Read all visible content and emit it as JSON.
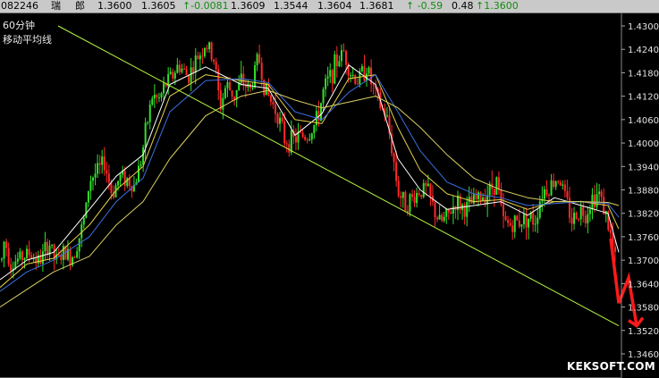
{
  "quote_bar": {
    "code": "082246",
    "name_1": "瑞",
    "name_2": "郎",
    "v1": "1.3600",
    "v2": "1.3605",
    "change": "↑-0.0081",
    "v3": "1.3609",
    "v4": "1.3544",
    "v5": "1.3604",
    "v6": "1.3681",
    "pct": "↑ -0.59",
    "v7": "0.48",
    "last": "↑1.3600"
  },
  "chart_data": {
    "type": "candlestick",
    "title": "60分钟",
    "subtitle": "移动平均线",
    "y_ticks": [
      "1.4300",
      "1.4240",
      "1.4180",
      "1.4120",
      "1.4060",
      "1.4000",
      "1.3940",
      "1.3880",
      "1.3820",
      "1.3760",
      "1.3700",
      "1.3640",
      "1.3580",
      "1.3520",
      "1.3460"
    ],
    "ylim": [
      1.3455,
      1.431
    ],
    "price_path": [
      [
        0,
        1.3665
      ],
      [
        5,
        1.3755
      ],
      [
        12,
        1.369
      ],
      [
        22,
        1.3705
      ],
      [
        33,
        1.3718
      ],
      [
        44,
        1.3695
      ],
      [
        55,
        1.3745
      ],
      [
        62,
        1.3695
      ],
      [
        72,
        1.372
      ],
      [
        80,
        1.3705
      ],
      [
        88,
        1.3755
      ],
      [
        95,
        1.381
      ],
      [
        100,
        1.3905
      ],
      [
        110,
        1.393
      ],
      [
        117,
        1.395
      ],
      [
        125,
        1.387
      ],
      [
        135,
        1.3915
      ],
      [
        143,
        1.3905
      ],
      [
        150,
        1.389
      ],
      [
        158,
        1.396
      ],
      [
        163,
        1.403
      ],
      [
        170,
        1.412
      ],
      [
        178,
        1.411
      ],
      [
        185,
        1.415
      ],
      [
        192,
        1.417
      ],
      [
        200,
        1.42
      ],
      [
        210,
        1.417
      ],
      [
        220,
        1.4215
      ],
      [
        230,
        1.4255
      ],
      [
        240,
        1.421
      ],
      [
        246,
        1.409
      ],
      [
        253,
        1.415
      ],
      [
        262,
        1.412
      ],
      [
        270,
        1.416
      ],
      [
        280,
        1.4135
      ],
      [
        289,
        1.4225
      ],
      [
        295,
        1.415
      ],
      [
        302,
        1.411
      ],
      [
        310,
        1.408
      ],
      [
        318,
        1.401
      ],
      [
        326,
        1.4005
      ],
      [
        336,
        1.4018
      ],
      [
        345,
        1.402
      ],
      [
        355,
        1.406
      ],
      [
        362,
        1.4135
      ],
      [
        370,
        1.4175
      ],
      [
        378,
        1.4215
      ],
      [
        385,
        1.4235
      ],
      [
        392,
        1.418
      ],
      [
        400,
        1.416
      ],
      [
        410,
        1.4195
      ],
      [
        417,
        1.414
      ],
      [
        425,
        1.4095
      ],
      [
        432,
        1.407
      ],
      [
        438,
        1.399
      ],
      [
        445,
        1.388
      ],
      [
        452,
        1.3845
      ],
      [
        460,
        1.3855
      ],
      [
        470,
        1.388
      ],
      [
        478,
        1.388
      ],
      [
        485,
        1.383
      ],
      [
        492,
        1.3795
      ],
      [
        500,
        1.381
      ],
      [
        510,
        1.385
      ],
      [
        520,
        1.383
      ],
      [
        530,
        1.385
      ],
      [
        540,
        1.3865
      ],
      [
        548,
        1.388
      ],
      [
        556,
        1.3905
      ],
      [
        562,
        1.38
      ],
      [
        570,
        1.379
      ],
      [
        580,
        1.38
      ],
      [
        590,
        1.381
      ],
      [
        598,
        1.38
      ],
      [
        606,
        1.3875
      ],
      [
        615,
        1.389
      ],
      [
        625,
        1.3915
      ],
      [
        632,
        1.386
      ],
      [
        640,
        1.38
      ],
      [
        648,
        1.383
      ],
      [
        655,
        1.382
      ],
      [
        662,
        1.386
      ],
      [
        670,
        1.387
      ],
      [
        676,
        1.383
      ],
      [
        682,
        1.377
      ],
      [
        688,
        1.37
      ],
      [
        692,
        1.3668
      ]
    ],
    "moving_averages": [
      {
        "color": "#ffffff",
        "values": [
          [
            0,
            1.365
          ],
          [
            30,
            1.37
          ],
          [
            60,
            1.372
          ],
          [
            100,
            1.383
          ],
          [
            130,
            1.3915
          ],
          [
            160,
            1.397
          ],
          [
            190,
            1.415
          ],
          [
            230,
            1.4195
          ],
          [
            270,
            1.415
          ],
          [
            300,
            1.414
          ],
          [
            330,
            1.402
          ],
          [
            360,
            1.4075
          ],
          [
            390,
            1.42
          ],
          [
            420,
            1.415
          ],
          [
            445,
            1.396
          ],
          [
            470,
            1.388
          ],
          [
            500,
            1.383
          ],
          [
            530,
            1.384
          ],
          [
            560,
            1.385
          ],
          [
            590,
            1.3815
          ],
          [
            620,
            1.386
          ],
          [
            650,
            1.384
          ],
          [
            680,
            1.382
          ],
          [
            692,
            1.372
          ]
        ]
      },
      {
        "color": "#e6d24a",
        "values": [
          [
            0,
            1.363
          ],
          [
            30,
            1.369
          ],
          [
            60,
            1.3705
          ],
          [
            100,
            1.379
          ],
          [
            130,
            1.388
          ],
          [
            160,
            1.394
          ],
          [
            190,
            1.412
          ],
          [
            230,
            1.4175
          ],
          [
            270,
            1.416
          ],
          [
            300,
            1.415
          ],
          [
            330,
            1.406
          ],
          [
            360,
            1.405
          ],
          [
            390,
            1.4165
          ],
          [
            420,
            1.4175
          ],
          [
            445,
            1.404
          ],
          [
            470,
            1.393
          ],
          [
            500,
            1.387
          ],
          [
            530,
            1.385
          ],
          [
            560,
            1.3855
          ],
          [
            590,
            1.383
          ],
          [
            620,
            1.385
          ],
          [
            650,
            1.385
          ],
          [
            680,
            1.384
          ],
          [
            692,
            1.378
          ]
        ]
      },
      {
        "color": "#3b6fe0",
        "values": [
          [
            0,
            1.362
          ],
          [
            30,
            1.367
          ],
          [
            60,
            1.37
          ],
          [
            100,
            1.376
          ],
          [
            130,
            1.385
          ],
          [
            160,
            1.391
          ],
          [
            190,
            1.408
          ],
          [
            230,
            1.416
          ],
          [
            270,
            1.4165
          ],
          [
            300,
            1.4155
          ],
          [
            330,
            1.408
          ],
          [
            360,
            1.406
          ],
          [
            390,
            1.413
          ],
          [
            420,
            1.4175
          ],
          [
            445,
            1.408
          ],
          [
            470,
            1.398
          ],
          [
            500,
            1.39
          ],
          [
            530,
            1.387
          ],
          [
            560,
            1.386
          ],
          [
            590,
            1.384
          ],
          [
            620,
            1.3845
          ],
          [
            650,
            1.385
          ],
          [
            680,
            1.3845
          ],
          [
            692,
            1.381
          ]
        ]
      },
      {
        "color": "#d8d060",
        "values": [
          [
            0,
            1.358
          ],
          [
            30,
            1.3625
          ],
          [
            60,
            1.367
          ],
          [
            100,
            1.371
          ],
          [
            130,
            1.379
          ],
          [
            160,
            1.385
          ],
          [
            190,
            1.396
          ],
          [
            230,
            1.407
          ],
          [
            270,
            1.412
          ],
          [
            300,
            1.4135
          ],
          [
            330,
            1.411
          ],
          [
            360,
            1.409
          ],
          [
            390,
            1.4105
          ],
          [
            420,
            1.412
          ],
          [
            445,
            1.409
          ],
          [
            470,
            1.404
          ],
          [
            500,
            1.397
          ],
          [
            530,
            1.391
          ],
          [
            560,
            1.388
          ],
          [
            590,
            1.386
          ],
          [
            620,
            1.385
          ],
          [
            650,
            1.385
          ],
          [
            680,
            1.3848
          ],
          [
            692,
            1.384
          ]
        ]
      }
    ],
    "trendline": {
      "color": "#b7f542",
      "from": [
        65,
        1.43
      ],
      "to": [
        692,
        1.3532
      ]
    },
    "arrow": {
      "color": "#ff1a1a",
      "points": [
        [
          683,
          1.3755
        ],
        [
          692,
          1.359
        ],
        [
          703,
          1.3655
        ],
        [
          712,
          1.3532
        ]
      ]
    }
  },
  "watermark": "KEKSOFT.COM"
}
